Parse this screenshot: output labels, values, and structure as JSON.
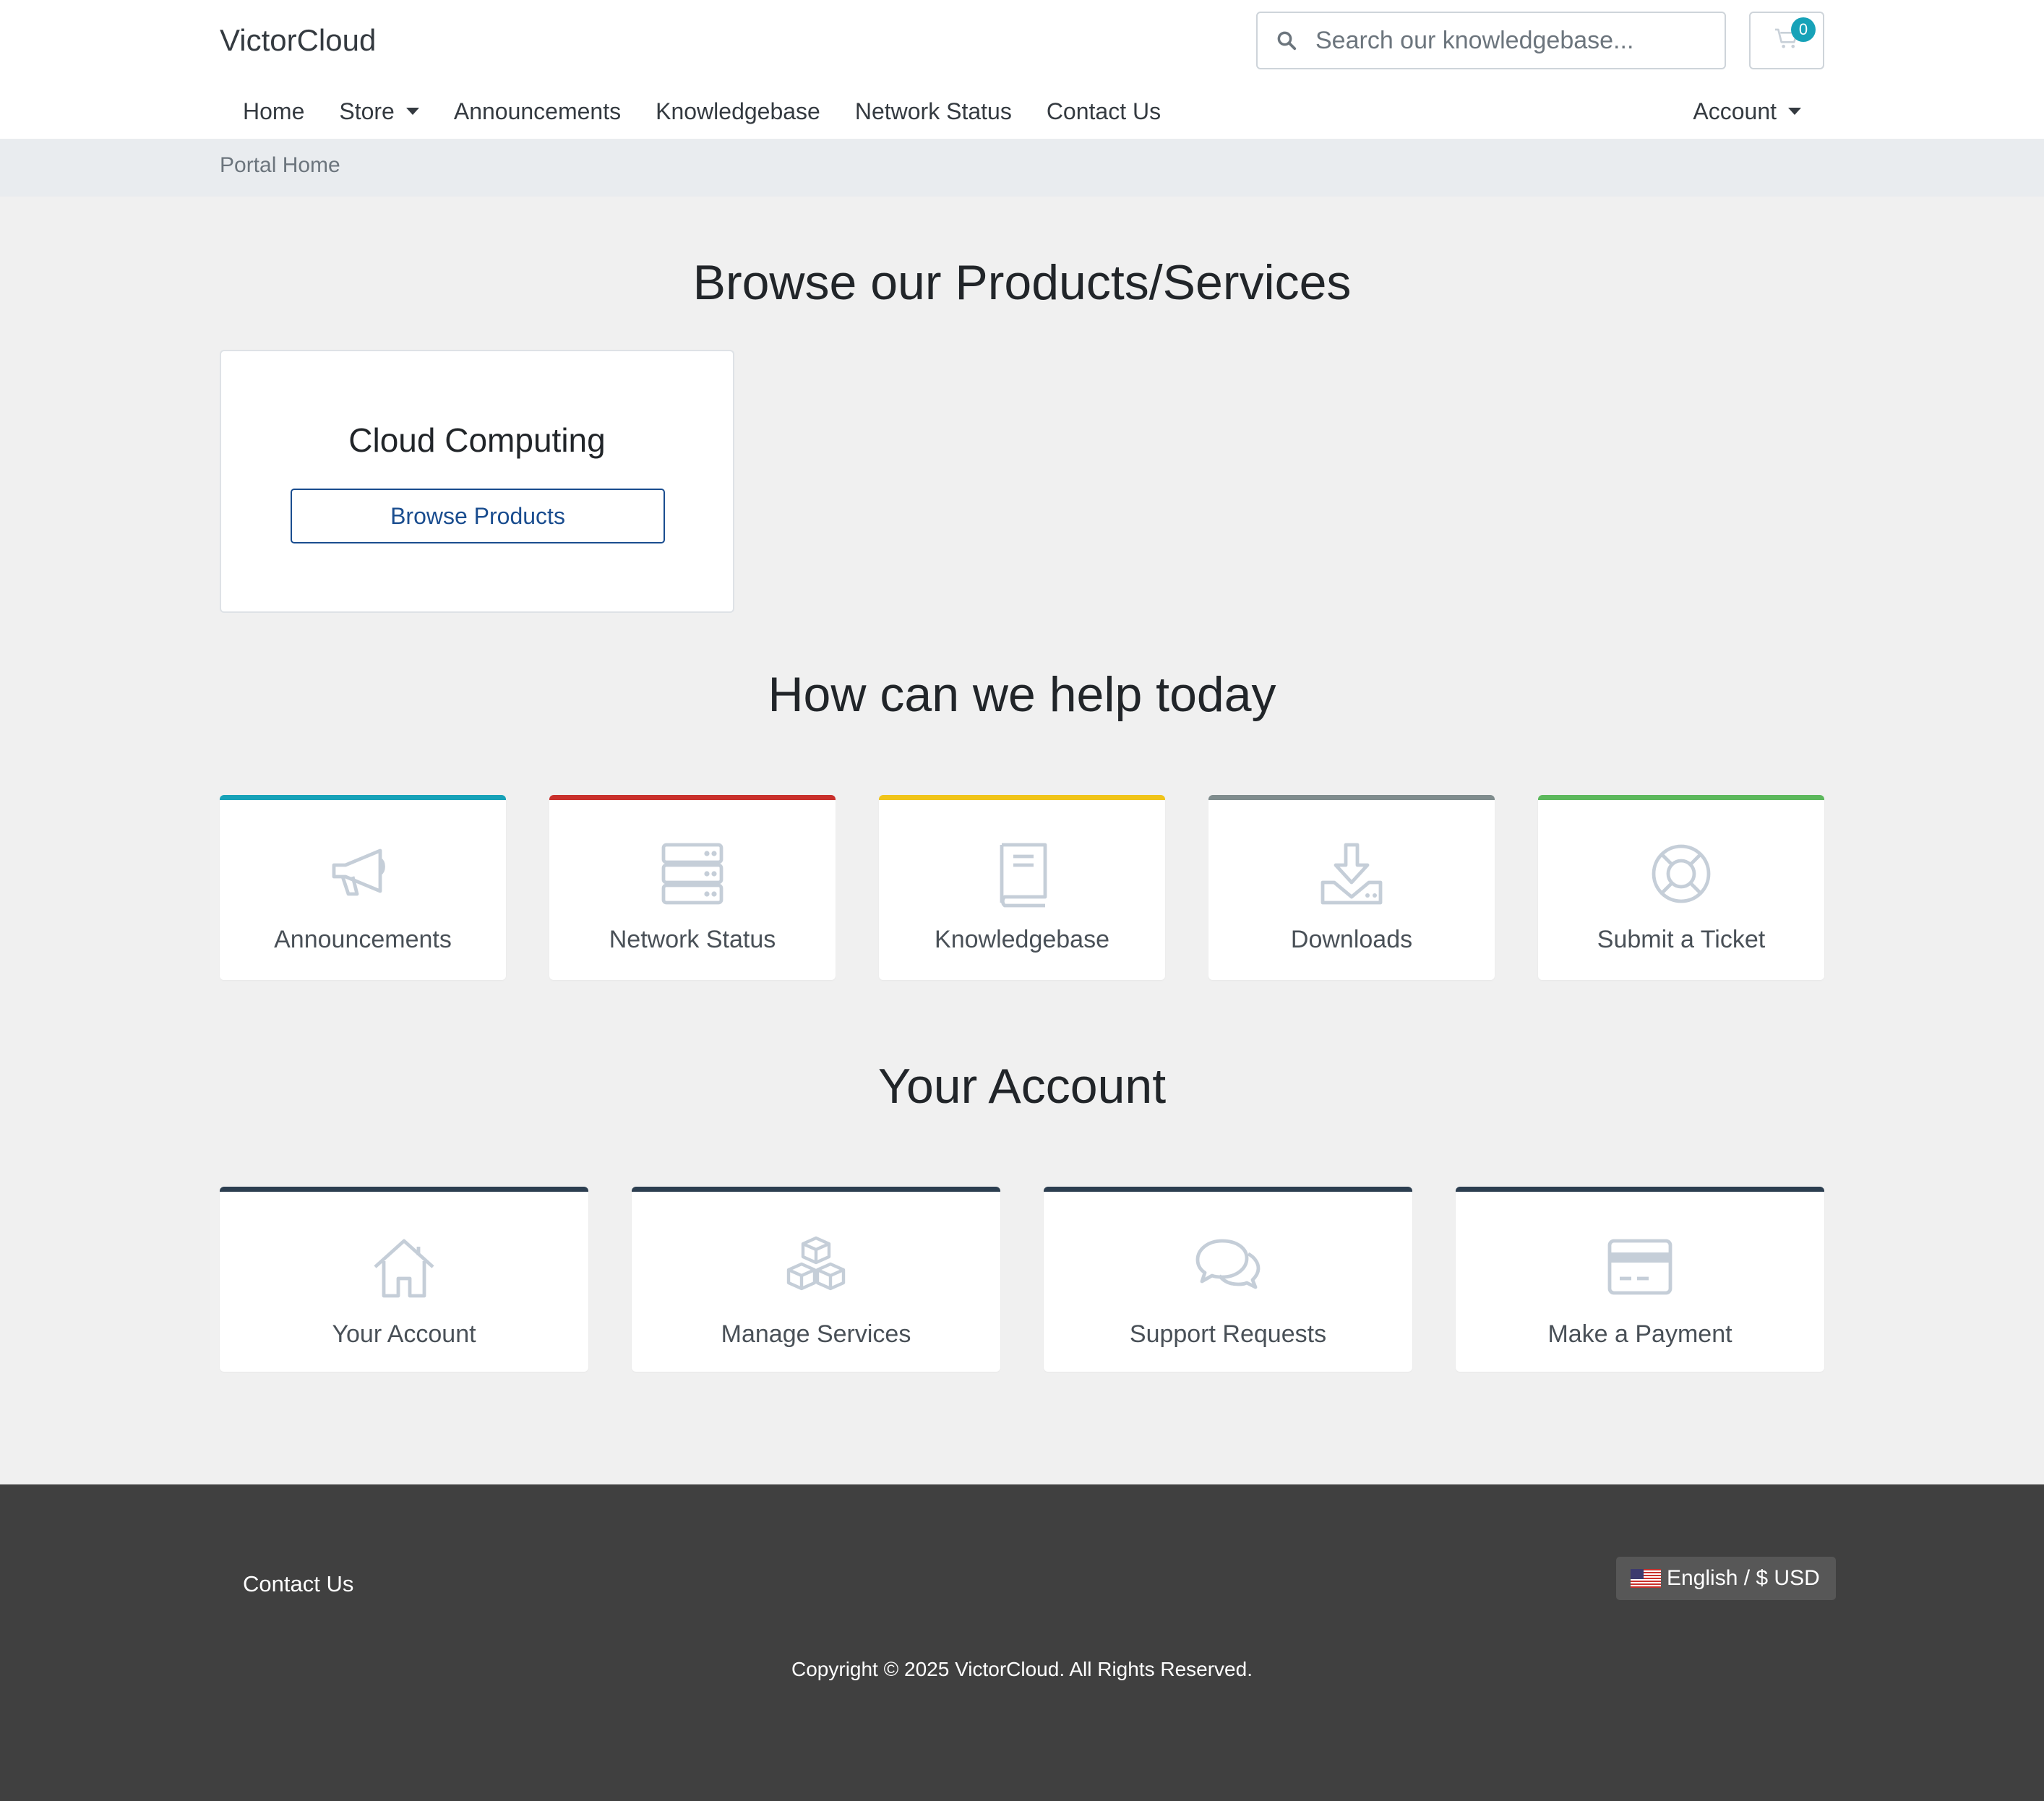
{
  "brand": "VictorCloud",
  "search": {
    "placeholder": "Search our knowledgebase..."
  },
  "cart": {
    "count": "0",
    "icon": "cart-icon"
  },
  "nav": {
    "home": "Home",
    "store": "Store",
    "announcements": "Announcements",
    "knowledgebase": "Knowledgebase",
    "network_status": "Network Status",
    "contact": "Contact Us",
    "account": "Account"
  },
  "breadcrumb": "Portal Home",
  "products": {
    "heading": "Browse our Products/Services",
    "card_title": "Cloud Computing",
    "button": "Browse Products"
  },
  "help": {
    "heading": "How can we help today",
    "cards": [
      {
        "label": "Announcements",
        "icon": "megaphone-icon",
        "color": "#17a2b8"
      },
      {
        "label": "Network Status",
        "icon": "server-icon",
        "color": "#c9302c"
      },
      {
        "label": "Knowledgebase",
        "icon": "book-icon",
        "color": "#f0c419"
      },
      {
        "label": "Downloads",
        "icon": "download-icon",
        "color": "#7f8c8d"
      },
      {
        "label": "Submit a Ticket",
        "icon": "lifebuoy-icon",
        "color": "#5cb85c"
      }
    ]
  },
  "account": {
    "heading": "Your Account",
    "cards": [
      {
        "label": "Your Account",
        "icon": "home-icon"
      },
      {
        "label": "Manage Services",
        "icon": "cubes-icon"
      },
      {
        "label": "Support Requests",
        "icon": "comments-icon"
      },
      {
        "label": "Make a Payment",
        "icon": "credit-card-icon"
      }
    ],
    "accent": "#2c3e50"
  },
  "footer": {
    "contact": "Contact Us",
    "language": "English / $ USD",
    "copyright": "Copyright © 2025 VictorCloud. All Rights Reserved."
  }
}
